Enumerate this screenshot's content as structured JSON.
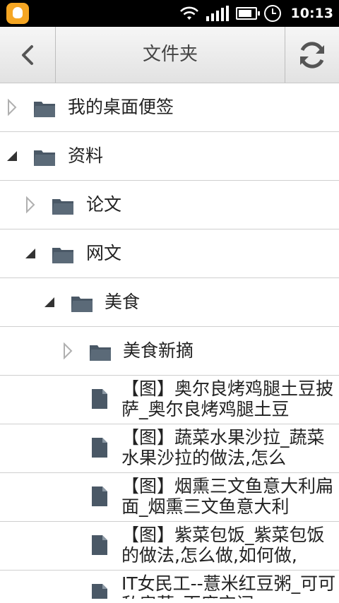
{
  "status_bar": {
    "time": "10:13",
    "icons": [
      "qq-notification-icon",
      "wifi-icon",
      "signal-icon",
      "battery-icon",
      "alarm-icon"
    ]
  },
  "title_bar": {
    "title": "文件夹",
    "back_icon": "back-chevron-icon",
    "refresh_icon": "refresh-icon"
  },
  "tree": [
    {
      "type": "folder",
      "depth": 0,
      "expanded": false,
      "label": "我的桌面便签"
    },
    {
      "type": "folder",
      "depth": 0,
      "expanded": true,
      "label": "资料"
    },
    {
      "type": "folder",
      "depth": 1,
      "expanded": false,
      "label": "论文"
    },
    {
      "type": "folder",
      "depth": 1,
      "expanded": true,
      "label": "网文"
    },
    {
      "type": "folder",
      "depth": 2,
      "expanded": true,
      "label": "美食"
    },
    {
      "type": "folder",
      "depth": 3,
      "expanded": false,
      "label": "美食新摘"
    },
    {
      "type": "file",
      "label": "【图】奥尔良烤鸡腿土豆披萨_奥尔良烤鸡腿土豆"
    },
    {
      "type": "file",
      "label": "【图】蔬菜水果沙拉_蔬菜水果沙拉的做法,怎么"
    },
    {
      "type": "file",
      "label": "【图】烟熏三文鱼意大利扁面_烟熏三文鱼意大利"
    },
    {
      "type": "file",
      "label": "【图】紫菜包饭_紫菜包饭的做法,怎么做,如何做,"
    },
    {
      "type": "file",
      "label": "IT女民工--薏米红豆粥_可可私房菜_百度空间"
    }
  ],
  "colors": {
    "folder": "#4a5866",
    "expander_collapsed": "#b0b0b0",
    "expander_expanded": "#333333",
    "title_text": "#444444",
    "divider": "#cfcfcf"
  }
}
